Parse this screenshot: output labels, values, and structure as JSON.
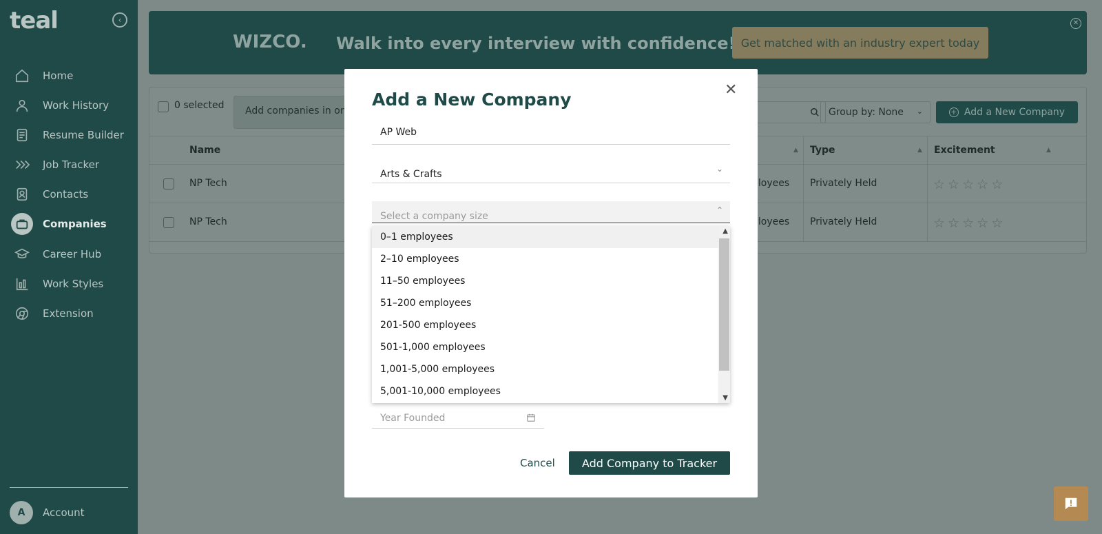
{
  "sidebar": {
    "logo": "teal",
    "items": [
      {
        "label": "Home",
        "icon": "home-icon"
      },
      {
        "label": "Work History",
        "icon": "person-icon"
      },
      {
        "label": "Resume Builder",
        "icon": "document-icon"
      },
      {
        "label": "Job Tracker",
        "icon": "chevrons-icon"
      },
      {
        "label": "Contacts",
        "icon": "contacts-icon"
      },
      {
        "label": "Companies",
        "icon": "briefcase-icon",
        "active": true
      },
      {
        "label": "Career Hub",
        "icon": "graduation-cap-icon"
      },
      {
        "label": "Work Styles",
        "icon": "bar-chart-icon"
      },
      {
        "label": "Extension",
        "icon": "chrome-icon"
      }
    ],
    "account": {
      "initial": "A",
      "label": "Account"
    }
  },
  "banner": {
    "logo": "WIZCO.",
    "headline": "Walk into every interview with confidence!",
    "cta": "Get matched with an industry expert today"
  },
  "toolbar": {
    "selected": "0 selected",
    "add_in_placeholder": "Add companies in one",
    "group_by": "Group by: None",
    "add_button": "Add a New Company"
  },
  "table": {
    "headers": {
      "name": "Name",
      "type": "Type",
      "excitement": "Excitement"
    },
    "rows": [
      {
        "name": "NP Tech",
        "size": "ployees",
        "type": "Privately Held"
      },
      {
        "name": "NP Tech",
        "size": "ployees",
        "type": "Privately Held"
      }
    ]
  },
  "modal": {
    "title": "Add a New Company",
    "company_name": "AP Web",
    "industry": "Arts & Crafts",
    "size_placeholder": "Select a company size",
    "size_options": [
      "0–1 employees",
      "2–10 employees",
      "11–50 employees",
      "51–200 employees",
      "201-500 employees",
      "501-1,000 employees",
      "1,001-5,000 employees",
      "5,001-10,000 employees"
    ],
    "year_placeholder": "Year Founded",
    "cancel": "Cancel",
    "submit": "Add Company to Tracker"
  },
  "colors": {
    "brand_dark": "#1f4a47",
    "cta_gold": "#847c5d",
    "feedback": "#b58a52"
  }
}
